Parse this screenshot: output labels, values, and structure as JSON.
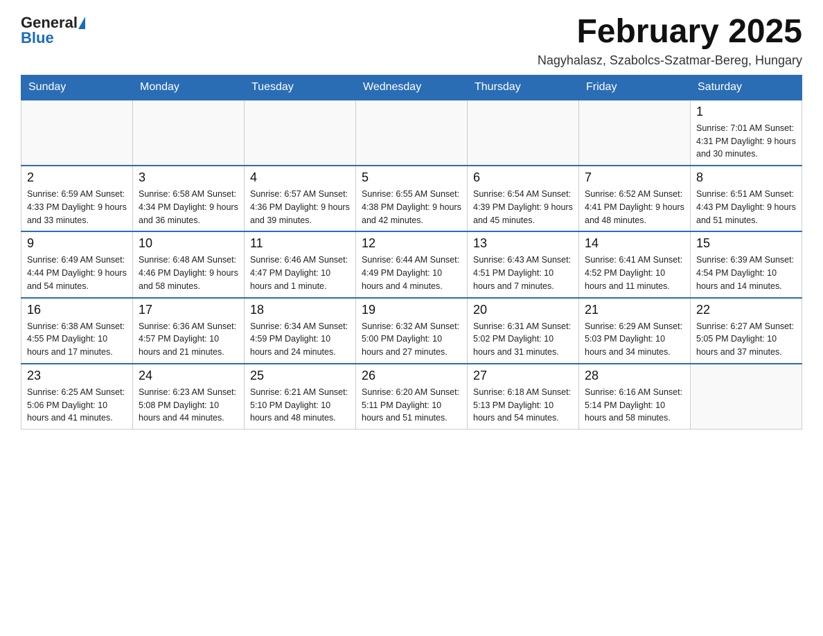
{
  "logo": {
    "text_general": "General",
    "text_blue": "Blue"
  },
  "title": "February 2025",
  "subtitle": "Nagyhalasz, Szabolcs-Szatmar-Bereg, Hungary",
  "weekdays": [
    "Sunday",
    "Monday",
    "Tuesday",
    "Wednesday",
    "Thursday",
    "Friday",
    "Saturday"
  ],
  "weeks": [
    [
      {
        "day": "",
        "info": ""
      },
      {
        "day": "",
        "info": ""
      },
      {
        "day": "",
        "info": ""
      },
      {
        "day": "",
        "info": ""
      },
      {
        "day": "",
        "info": ""
      },
      {
        "day": "",
        "info": ""
      },
      {
        "day": "1",
        "info": "Sunrise: 7:01 AM\nSunset: 4:31 PM\nDaylight: 9 hours and 30 minutes."
      }
    ],
    [
      {
        "day": "2",
        "info": "Sunrise: 6:59 AM\nSunset: 4:33 PM\nDaylight: 9 hours and 33 minutes."
      },
      {
        "day": "3",
        "info": "Sunrise: 6:58 AM\nSunset: 4:34 PM\nDaylight: 9 hours and 36 minutes."
      },
      {
        "day": "4",
        "info": "Sunrise: 6:57 AM\nSunset: 4:36 PM\nDaylight: 9 hours and 39 minutes."
      },
      {
        "day": "5",
        "info": "Sunrise: 6:55 AM\nSunset: 4:38 PM\nDaylight: 9 hours and 42 minutes."
      },
      {
        "day": "6",
        "info": "Sunrise: 6:54 AM\nSunset: 4:39 PM\nDaylight: 9 hours and 45 minutes."
      },
      {
        "day": "7",
        "info": "Sunrise: 6:52 AM\nSunset: 4:41 PM\nDaylight: 9 hours and 48 minutes."
      },
      {
        "day": "8",
        "info": "Sunrise: 6:51 AM\nSunset: 4:43 PM\nDaylight: 9 hours and 51 minutes."
      }
    ],
    [
      {
        "day": "9",
        "info": "Sunrise: 6:49 AM\nSunset: 4:44 PM\nDaylight: 9 hours and 54 minutes."
      },
      {
        "day": "10",
        "info": "Sunrise: 6:48 AM\nSunset: 4:46 PM\nDaylight: 9 hours and 58 minutes."
      },
      {
        "day": "11",
        "info": "Sunrise: 6:46 AM\nSunset: 4:47 PM\nDaylight: 10 hours and 1 minute."
      },
      {
        "day": "12",
        "info": "Sunrise: 6:44 AM\nSunset: 4:49 PM\nDaylight: 10 hours and 4 minutes."
      },
      {
        "day": "13",
        "info": "Sunrise: 6:43 AM\nSunset: 4:51 PM\nDaylight: 10 hours and 7 minutes."
      },
      {
        "day": "14",
        "info": "Sunrise: 6:41 AM\nSunset: 4:52 PM\nDaylight: 10 hours and 11 minutes."
      },
      {
        "day": "15",
        "info": "Sunrise: 6:39 AM\nSunset: 4:54 PM\nDaylight: 10 hours and 14 minutes."
      }
    ],
    [
      {
        "day": "16",
        "info": "Sunrise: 6:38 AM\nSunset: 4:55 PM\nDaylight: 10 hours and 17 minutes."
      },
      {
        "day": "17",
        "info": "Sunrise: 6:36 AM\nSunset: 4:57 PM\nDaylight: 10 hours and 21 minutes."
      },
      {
        "day": "18",
        "info": "Sunrise: 6:34 AM\nSunset: 4:59 PM\nDaylight: 10 hours and 24 minutes."
      },
      {
        "day": "19",
        "info": "Sunrise: 6:32 AM\nSunset: 5:00 PM\nDaylight: 10 hours and 27 minutes."
      },
      {
        "day": "20",
        "info": "Sunrise: 6:31 AM\nSunset: 5:02 PM\nDaylight: 10 hours and 31 minutes."
      },
      {
        "day": "21",
        "info": "Sunrise: 6:29 AM\nSunset: 5:03 PM\nDaylight: 10 hours and 34 minutes."
      },
      {
        "day": "22",
        "info": "Sunrise: 6:27 AM\nSunset: 5:05 PM\nDaylight: 10 hours and 37 minutes."
      }
    ],
    [
      {
        "day": "23",
        "info": "Sunrise: 6:25 AM\nSunset: 5:06 PM\nDaylight: 10 hours and 41 minutes."
      },
      {
        "day": "24",
        "info": "Sunrise: 6:23 AM\nSunset: 5:08 PM\nDaylight: 10 hours and 44 minutes."
      },
      {
        "day": "25",
        "info": "Sunrise: 6:21 AM\nSunset: 5:10 PM\nDaylight: 10 hours and 48 minutes."
      },
      {
        "day": "26",
        "info": "Sunrise: 6:20 AM\nSunset: 5:11 PM\nDaylight: 10 hours and 51 minutes."
      },
      {
        "day": "27",
        "info": "Sunrise: 6:18 AM\nSunset: 5:13 PM\nDaylight: 10 hours and 54 minutes."
      },
      {
        "day": "28",
        "info": "Sunrise: 6:16 AM\nSunset: 5:14 PM\nDaylight: 10 hours and 58 minutes."
      },
      {
        "day": "",
        "info": ""
      }
    ]
  ]
}
